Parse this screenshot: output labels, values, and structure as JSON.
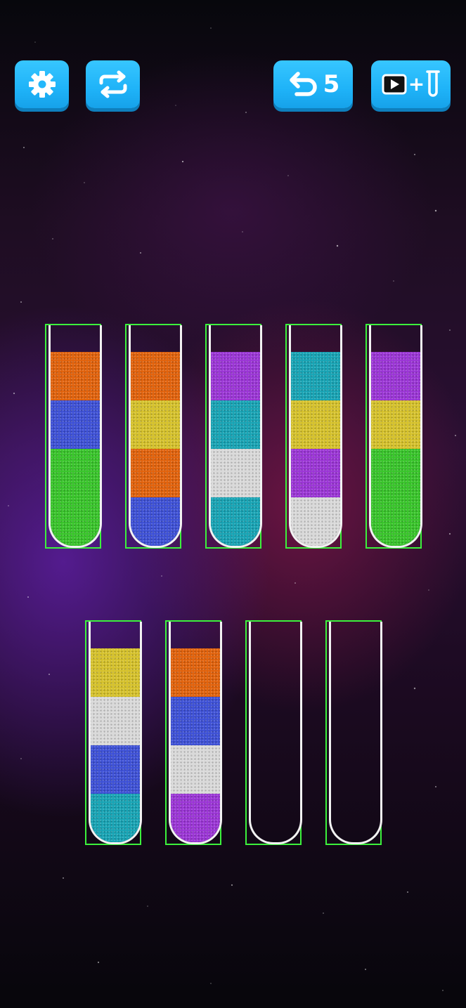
{
  "toolbar": {
    "settings": {
      "icon": "gear-icon"
    },
    "restart": {
      "icon": "restart-arrows-icon"
    },
    "undo": {
      "icon": "undo-arrow-icon",
      "count": "5"
    },
    "add_tube": {
      "icons": [
        "play-video-icon",
        "plus-icon",
        "test-tube-icon"
      ],
      "plus": "+"
    }
  },
  "colors": {
    "orange": "#e2620b",
    "blue": "#3d50d6",
    "green": "#38c52a",
    "yellow": "#d6c22b",
    "purple": "#9b35d6",
    "teal": "#17a4b5",
    "white": "#d9d9d9"
  },
  "tubes": [
    {
      "id": 1,
      "row": 1,
      "layers_top_to_bottom": [
        "orange",
        "blue",
        "green",
        "green"
      ]
    },
    {
      "id": 2,
      "row": 1,
      "layers_top_to_bottom": [
        "orange",
        "yellow",
        "orange",
        "blue"
      ]
    },
    {
      "id": 3,
      "row": 1,
      "layers_top_to_bottom": [
        "purple",
        "teal",
        "white",
        "teal"
      ]
    },
    {
      "id": 4,
      "row": 1,
      "layers_top_to_bottom": [
        "teal",
        "yellow",
        "purple",
        "white"
      ]
    },
    {
      "id": 5,
      "row": 1,
      "layers_top_to_bottom": [
        "purple",
        "yellow",
        "green",
        "green"
      ]
    },
    {
      "id": 6,
      "row": 2,
      "layers_top_to_bottom": [
        "yellow",
        "white",
        "blue",
        "teal"
      ]
    },
    {
      "id": 7,
      "row": 2,
      "layers_top_to_bottom": [
        "orange",
        "blue",
        "white",
        "purple"
      ]
    },
    {
      "id": 8,
      "row": 2,
      "layers_top_to_bottom": []
    },
    {
      "id": 9,
      "row": 2,
      "layers_top_to_bottom": []
    }
  ]
}
